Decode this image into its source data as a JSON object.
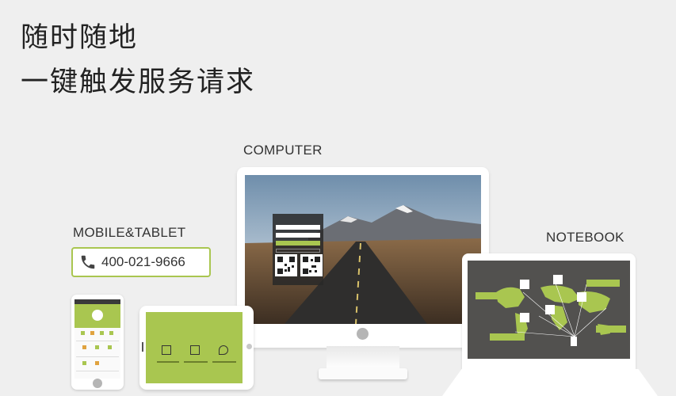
{
  "headline": {
    "line1": "随时随地",
    "line2": "一键触发服务请求"
  },
  "labels": {
    "computer": "COMPUTER",
    "mobile_tablet": "MOBILE&TABLET",
    "notebook": "NOTEBOOK"
  },
  "phone_number": "400-021-9666",
  "colors": {
    "accent_green": "#a9c650",
    "background": "#efefef",
    "notebook_screen": "#52514f"
  },
  "icons": [
    "phone-icon",
    "qr-code-icon",
    "world-map-icon",
    "location-pin-icon"
  ]
}
